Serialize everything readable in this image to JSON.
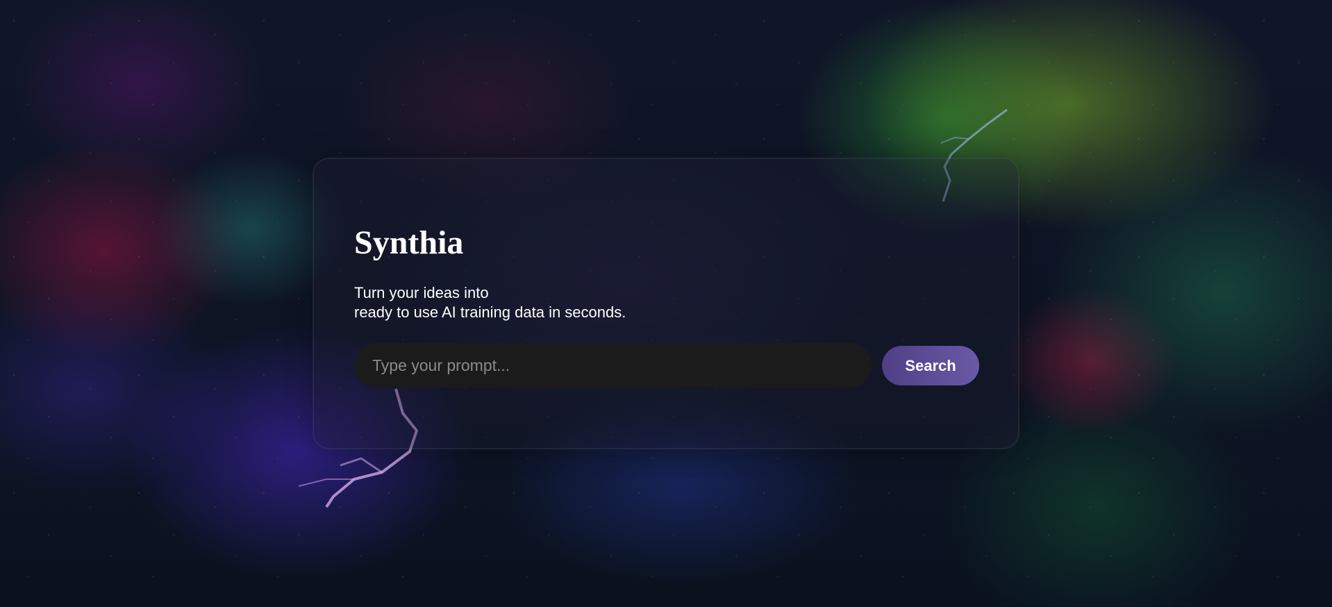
{
  "hero": {
    "title": "Synthia",
    "tagline_line1": "Turn your ideas into",
    "tagline_line2": "ready to use AI training data in seconds."
  },
  "search": {
    "placeholder": "Type your prompt...",
    "value": "",
    "button_label": "Search"
  },
  "colors": {
    "button_start": "#4e3f86",
    "button_end": "#6a5aa6",
    "input_bg": "#1b1b1b",
    "text": "#ffffff"
  }
}
